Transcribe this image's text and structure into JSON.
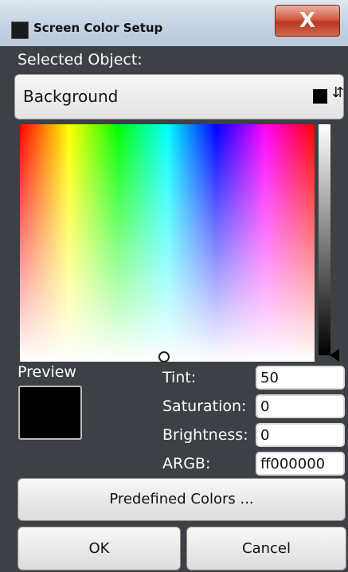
{
  "window": {
    "title": "Screen Color Setup",
    "close_label": "X",
    "app_icon": "rs-app-icon"
  },
  "selected_object": {
    "label": "Selected Object:",
    "value": "Background",
    "swatch_color": "#000000"
  },
  "color_picker": {
    "spectrum_colors": [
      "#ff0000",
      "#ffff00",
      "#00ff00",
      "#00ffff",
      "#0000ff",
      "#ff00ff",
      "#ff0000"
    ]
  },
  "preview": {
    "label": "Preview",
    "color": "#000000"
  },
  "fields": {
    "tint": {
      "label": "Tint:",
      "value": "50"
    },
    "saturation": {
      "label": "Saturation:",
      "value": "0"
    },
    "brightness": {
      "label": "Brightness:",
      "value": "0"
    },
    "argb": {
      "label": "ARGB:",
      "value": "ff000000"
    }
  },
  "buttons": {
    "predefined": "Predefined Colors ...",
    "ok": "OK",
    "cancel": "Cancel"
  }
}
